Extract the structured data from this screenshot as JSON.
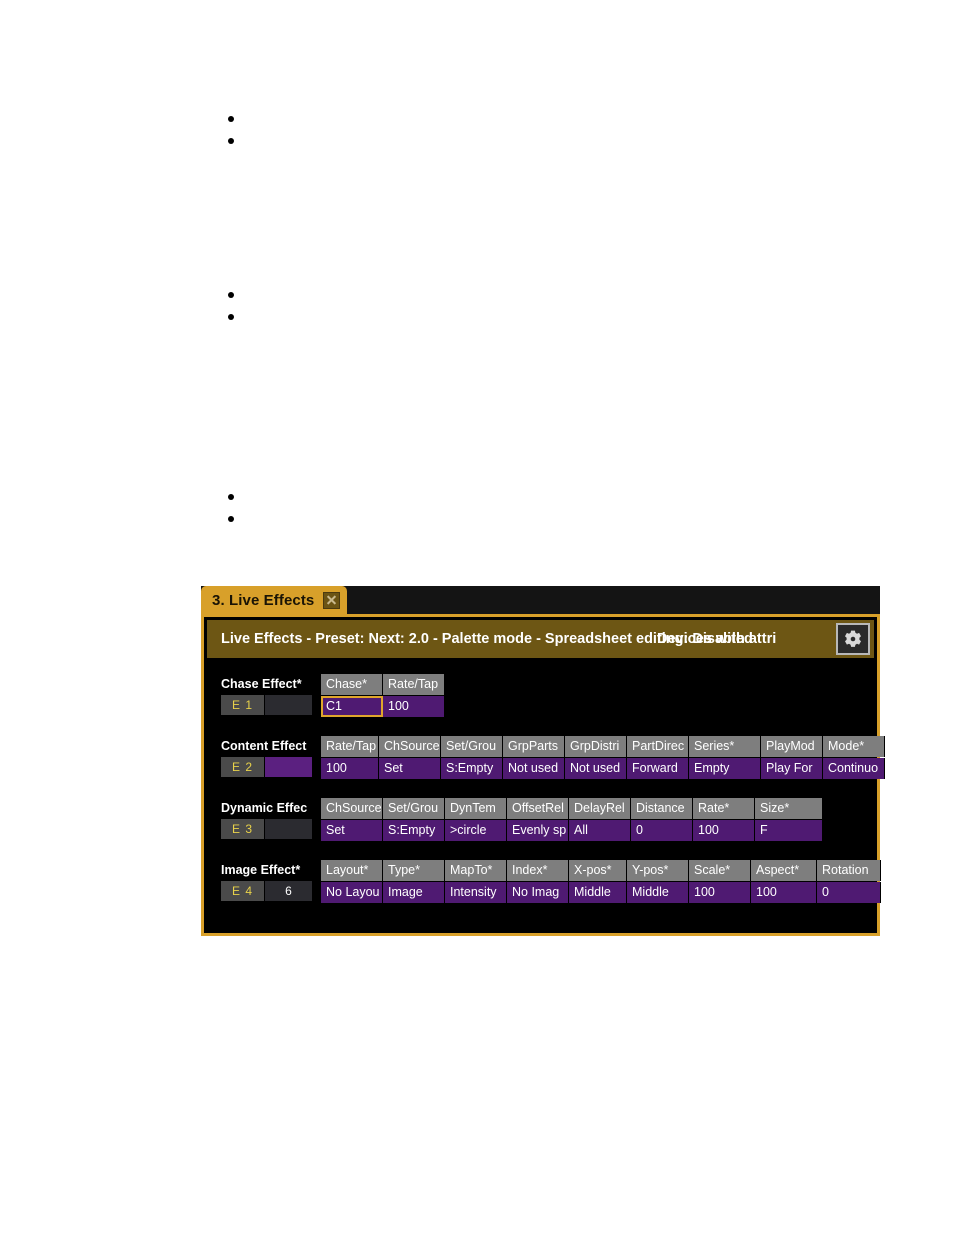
{
  "document": {
    "bullet_groups": [
      {
        "bullets": [
          "",
          ""
        ]
      },
      {
        "bullets": [
          "",
          ""
        ]
      },
      {
        "bullets": [
          "",
          ""
        ]
      }
    ]
  },
  "window": {
    "tab": {
      "label": "3. Live Effects",
      "close_icon": "close-icon"
    },
    "titlebar": {
      "text": "Live Effects - Preset:  Next: 2.0 - Palette mode - Spreadsheet editing: Disabled",
      "overlay_text": "Devices with attri",
      "gear_icon": "gear-icon"
    },
    "colors": {
      "accent": "#d8a02a",
      "titlebar_bg": "#6d5614",
      "header_cell": "#7e7e7e",
      "value_cell": "#4f1a72",
      "selection": "#e0a62c",
      "id_text": "#e8d24a",
      "window_bg": "#000000"
    },
    "rows": [
      {
        "title": "Chase Effect*",
        "id": "E 1",
        "id_value": "",
        "id_value_style": "dark",
        "headers": [
          "Chase*",
          "Rate/Tap"
        ],
        "values": [
          "C1",
          "100"
        ],
        "selected_index": 0
      },
      {
        "title": "Content Effect",
        "id": "E 2",
        "id_value": "",
        "id_value_style": "purple",
        "headers": [
          "Rate/Tap",
          "ChSource",
          "Set/Grou",
          "GrpParts",
          "GrpDistri",
          "PartDirec",
          "Series*",
          "PlayMod",
          "Mode*"
        ],
        "values": [
          "100",
          "Set",
          "S:Empty",
          "Not used",
          "Not used",
          "Forward",
          "Empty",
          "Play For",
          "Continuo"
        ],
        "selected_index": -1
      },
      {
        "title": "Dynamic Effec",
        "id": "E 3",
        "id_value": "",
        "id_value_style": "dark",
        "headers": [
          "ChSource",
          "Set/Grou",
          "DynTem",
          "OffsetRel",
          "DelayRel",
          "Distance",
          "Rate*",
          "Size*"
        ],
        "values": [
          "Set",
          "S:Empty",
          ">circle",
          "Evenly sp",
          "All",
          "0",
          "100",
          "F"
        ],
        "selected_index": -1
      },
      {
        "title": "Image Effect*",
        "id": "E 4",
        "id_value": "6",
        "id_value_style": "dark",
        "headers": [
          "Layout*",
          "Type*",
          "MapTo*",
          "Index*",
          "X-pos*",
          "Y-pos*",
          "Scale*",
          "Aspect*",
          "Rotation"
        ],
        "values": [
          "No Layou",
          "Image",
          "Intensity",
          "No Imag",
          "Middle",
          "Middle",
          "100",
          "100",
          "0"
        ],
        "selected_index": -1
      }
    ]
  }
}
